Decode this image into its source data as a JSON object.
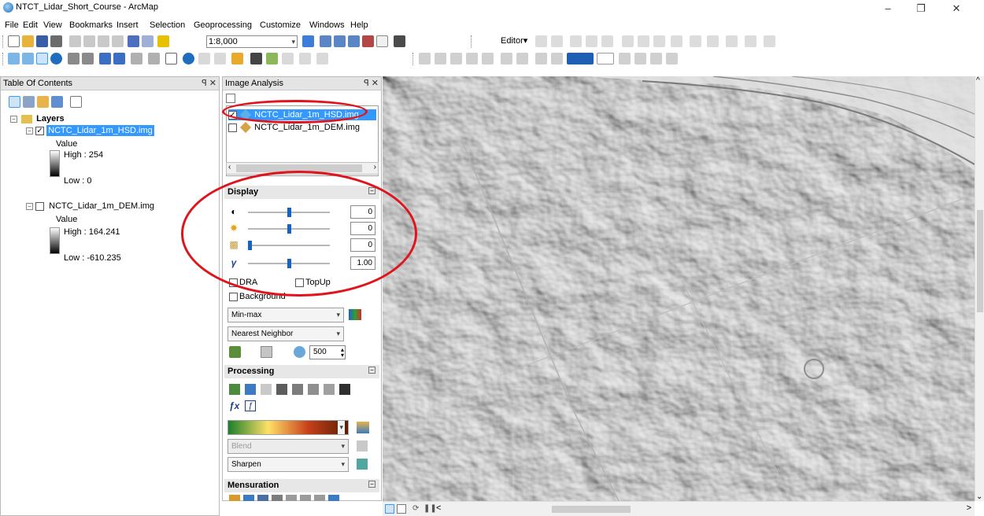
{
  "window": {
    "title": "NTCT_Lidar_Short_Course - ArcMap",
    "minimize": "–",
    "restore": "❐",
    "close": "✕"
  },
  "menu": [
    "File",
    "Edit",
    "View",
    "Bookmarks",
    "Insert",
    "Selection",
    "Geoprocessing",
    "Customize",
    "Windows",
    "Help"
  ],
  "toolbar": {
    "scale": "1:8,000",
    "editor_label": "Editor▾"
  },
  "toc": {
    "title": "Table Of Contents",
    "pin": "ꟼ ✕",
    "root_label": "Layers",
    "layers": [
      {
        "name": "NCTC_Lidar_1m_HSD.img",
        "checked": "✓",
        "value_label": "Value",
        "high": "High : 254",
        "low": "Low : 0"
      },
      {
        "name": "NCTC_Lidar_1m_DEM.img",
        "checked": "",
        "value_label": "Value",
        "high": "High : 164.241",
        "low": "Low : -610.235"
      }
    ]
  },
  "image_analysis": {
    "title": "Image Analysis",
    "pin": "ꟼ ✕",
    "list": [
      {
        "name": "NCTC_Lidar_1m_HSD.img",
        "checked": "✓"
      },
      {
        "name": "NCTC_Lidar_1m_DEM.img",
        "checked": ""
      }
    ],
    "display": {
      "title": "Display",
      "sliders": [
        {
          "icon": "contrast-icon",
          "glyph": "◐",
          "value": "0"
        },
        {
          "icon": "brightness-icon",
          "glyph": "✸",
          "value": "0"
        },
        {
          "icon": "transparency-icon",
          "glyph": "▩",
          "value": "0"
        },
        {
          "icon": "gamma-icon",
          "glyph": "γ",
          "value": "1.00"
        }
      ],
      "dra_label": "DRA",
      "topup_label": "TopUp",
      "background_label": "Background",
      "stretch": "Min-max",
      "resampling": "Nearest Neighbor",
      "zoom_value": "500"
    },
    "processing": {
      "title": "Processing",
      "blend_label": "Blend",
      "sharpen_label": "Sharpen"
    },
    "mensuration": {
      "title": "Mensuration"
    }
  },
  "map": {
    "scroll_arrows": {
      "up": "^",
      "down": "⌄",
      "left": "<",
      "right": ">"
    }
  },
  "colors": {
    "highlight": "#3399ff",
    "annotation_red": "#e0141c",
    "hillshade_base": "#d8d8d8"
  }
}
